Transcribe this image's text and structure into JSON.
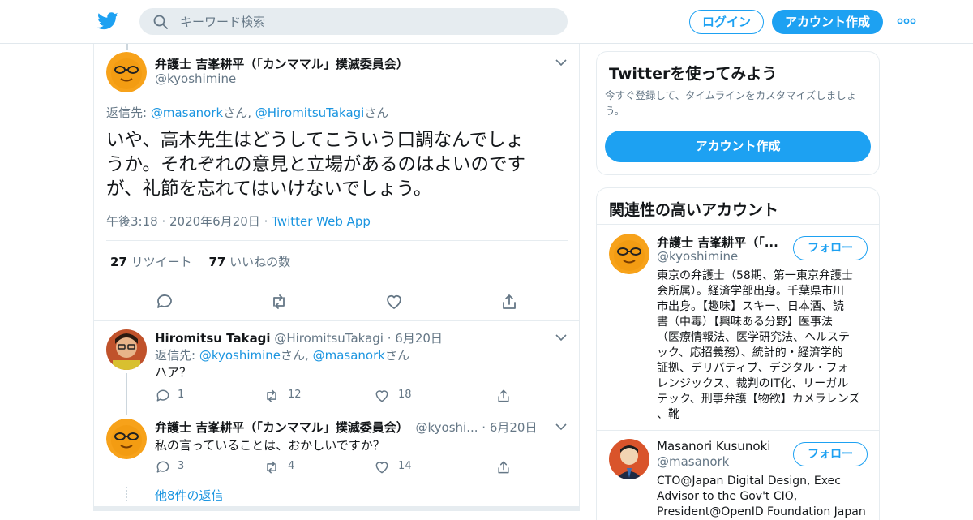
{
  "header": {
    "search_placeholder": "キーワード検索",
    "login_label": "ログイン",
    "signup_label": "アカウント作成"
  },
  "main_tweet": {
    "author_name": "弁護士 吉峯耕平（「カンママル」撲滅委員会）",
    "author_handle": "@kyoshimine",
    "reply_prefix": "返信先: ",
    "reply_to_1": "@masanork",
    "reply_sep_1": "さん, ",
    "reply_to_2": "@HiromitsuTakagi",
    "reply_sep_2": "さん",
    "text_line1": "いや、高木先生はどうしてこういう口調なんでしょ",
    "text_line2": "うか。それぞれの意見と立場があるのはよいのです",
    "text_line3": "が、礼節を忘れてはいけないでしょう。",
    "time": "午後3:18",
    "date": "2020年6月20日",
    "source": "Twitter Web App",
    "retweet_count": "27",
    "retweet_label": "リツイート",
    "like_count": "77",
    "like_label": "いいねの数"
  },
  "replies": [
    {
      "author_name": "Hiromitsu Takagi",
      "author_handle": "@HiromitsuTakagi",
      "date": "6月20日",
      "reply_prefix": "返信先: ",
      "reply_to_1": "@kyoshimine",
      "reply_sep_1": "さん, ",
      "reply_to_2": "@masanork",
      "reply_sep_2": "さん",
      "text": "ハア？",
      "reply_count": "1",
      "retweet_count": "12",
      "like_count": "18"
    },
    {
      "author_name": "弁護士 吉峯耕平（「カンママル」撲滅委員会）",
      "author_handle": "@kyoshi...",
      "date": "6月20日",
      "text": "私の言っていることは、おかしいですか？",
      "reply_count": "3",
      "retweet_count": "4",
      "like_count": "14"
    }
  ],
  "more_replies": "他8件の返信",
  "signup_card": {
    "title": "Twitterを使ってみよう",
    "desc_line1": "今すぐ登録して、タイムラインをカスタマイズしましょ",
    "desc_line2": "う。",
    "button": "アカウント作成"
  },
  "related": {
    "title": "関連性の高いアカウント",
    "follow_label": "フォロー",
    "accounts": [
      {
        "name": "弁護士 吉峯耕平（「...",
        "handle": "@kyoshimine",
        "bio_lines": [
          "東京の弁護士（58期、第一東京弁護士",
          "会所属）。経済学部出身。千葉県市川",
          "市出身。【趣味】スキー、日本酒、読",
          "書（中毒）【興味ある分野】医事法",
          "（医療情報法、医学研究法、ヘルステ",
          "ック、応招義務）、統計的・経済学的",
          "証拠、デリバティブ、デジタル・フォ",
          "レンジックス、裁判のIT化、リーガル",
          "テック、刑事弁護【物欲】カメラレンズ",
          "、靴"
        ]
      },
      {
        "name": "Masanori Kusunoki",
        "handle": "@masanork",
        "bio_lines": [
          "CTO@Japan Digital Design, Exec",
          "Advisor to the Gov't CIO,",
          "President@OpenID Foundation Japan"
        ]
      }
    ]
  },
  "colors": {
    "accent": "#1da1f2",
    "link": "#1b95e0",
    "muted": "#657786",
    "border": "#e6ecf0"
  }
}
